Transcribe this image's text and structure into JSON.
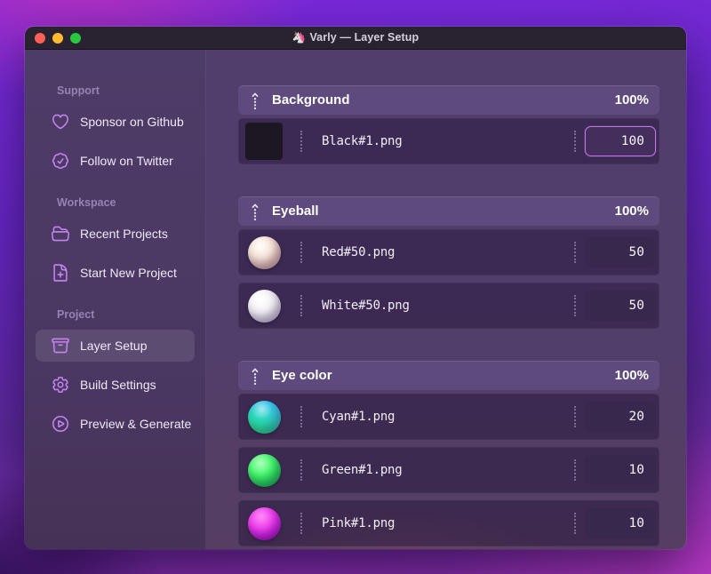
{
  "window": {
    "app_icon": "🦄",
    "title": "Varly — Layer Setup"
  },
  "sidebar": {
    "sections": [
      {
        "label": "Support",
        "items": [
          {
            "icon": "heart-icon",
            "label": "Sponsor on Github"
          },
          {
            "icon": "check-badge-icon",
            "label": "Follow on Twitter"
          }
        ]
      },
      {
        "label": "Workspace",
        "items": [
          {
            "icon": "folder-open-icon",
            "label": "Recent Projects"
          },
          {
            "icon": "document-plus-icon",
            "label": "Start New Project"
          }
        ]
      },
      {
        "label": "Project",
        "items": [
          {
            "icon": "archive-box-icon",
            "label": "Layer Setup",
            "active": true
          },
          {
            "icon": "gear-icon",
            "label": "Build Settings"
          },
          {
            "icon": "play-circle-icon",
            "label": "Preview & Generate"
          }
        ]
      }
    ]
  },
  "layers": {
    "groups": [
      {
        "title": "Background",
        "weight": "100%",
        "rows": [
          {
            "thumbnail": "black-swatch",
            "filename": "Black#1.png",
            "value": "100",
            "focused": true
          }
        ]
      },
      {
        "title": "Eyeball",
        "weight": "100%",
        "rows": [
          {
            "thumbnail": "red-ball",
            "filename": "Red#50.png",
            "value": "50",
            "focused": false
          },
          {
            "thumbnail": "white-ball",
            "filename": "White#50.png",
            "value": "50",
            "focused": false
          }
        ]
      },
      {
        "title": "Eye color",
        "weight": "100%",
        "rows": [
          {
            "thumbnail": "cyan-ball",
            "filename": "Cyan#1.png",
            "value": "20",
            "focused": false
          },
          {
            "thumbnail": "green-ball",
            "filename": "Green#1.png",
            "value": "10",
            "focused": false
          },
          {
            "thumbnail": "pink-ball",
            "filename": "Pink#1.png",
            "value": "10",
            "focused": false
          }
        ]
      }
    ]
  },
  "colors": {
    "accent": "#c873e8",
    "icon": "#c583f2",
    "traffic_red": "#ff5f57",
    "traffic_yellow": "#febc2e",
    "traffic_green": "#28c840"
  }
}
